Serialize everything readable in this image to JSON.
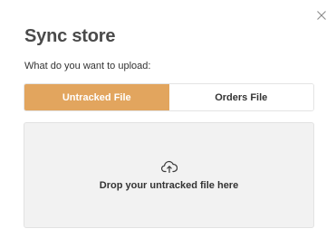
{
  "modal": {
    "title": "Sync store",
    "question": "What do you want to upload:",
    "close_icon": "close-icon"
  },
  "toggle": {
    "options": [
      {
        "label": "Untracked File",
        "selected": true
      },
      {
        "label": "Orders File",
        "selected": false
      }
    ]
  },
  "dropzone": {
    "icon": "cloud-upload-icon",
    "text": "Drop your untracked file here"
  },
  "colors": {
    "accent": "#e2a55e",
    "dropzone_bg": "#f2f2f2",
    "title": "#4a4a4a"
  }
}
